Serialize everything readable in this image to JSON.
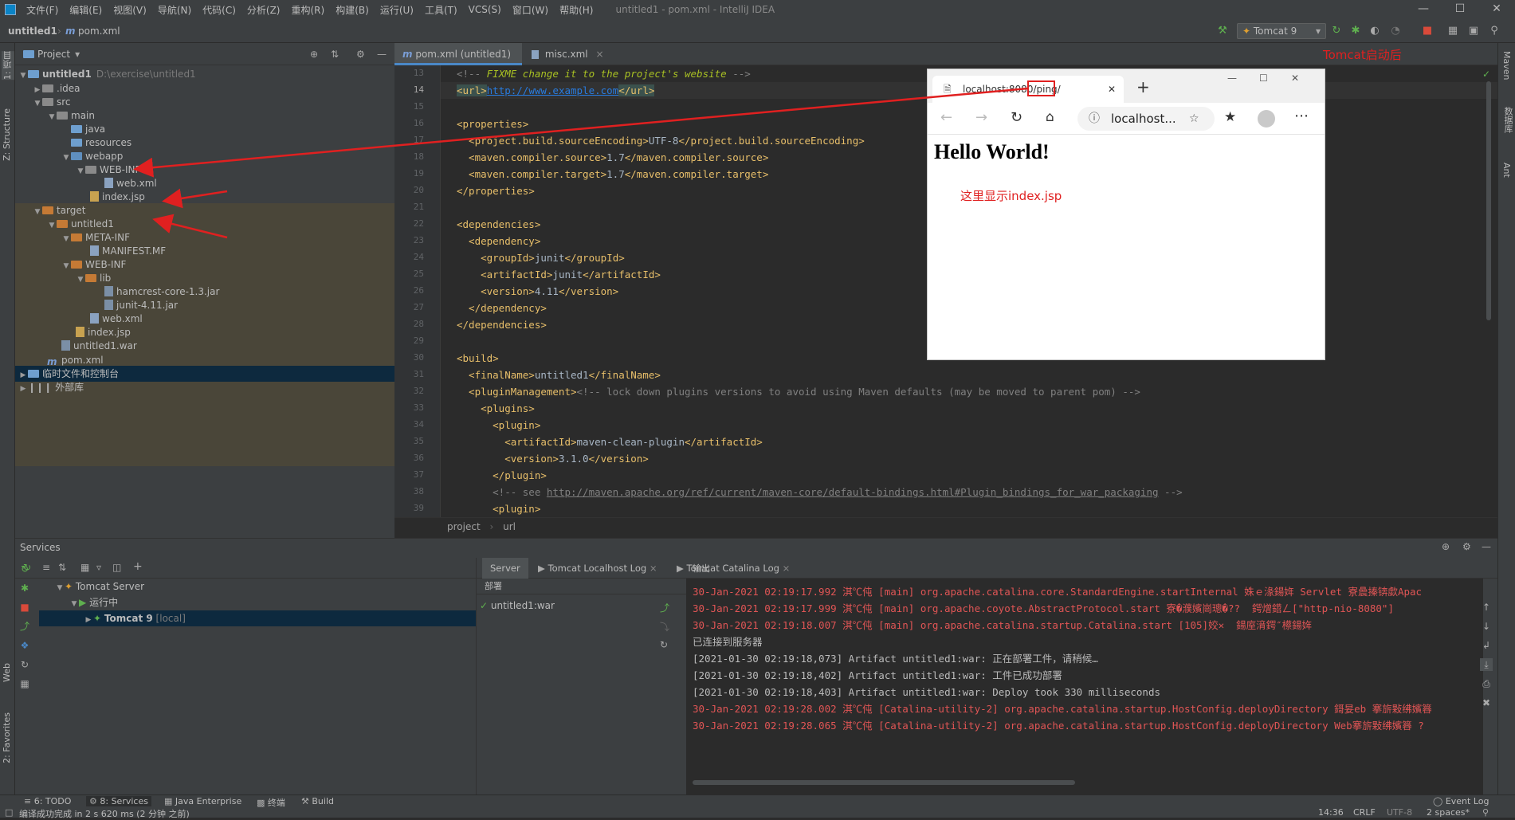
{
  "menubar": {
    "items": [
      "文件(F)",
      "编辑(E)",
      "视图(V)",
      "导航(N)",
      "代码(C)",
      "分析(Z)",
      "重构(R)",
      "构建(B)",
      "运行(U)",
      "工具(T)",
      "VCS(S)",
      "窗口(W)",
      "帮助(H)"
    ],
    "window_title": "untitled1 - pom.xml - IntelliJ IDEA"
  },
  "navbar": {
    "project": "untitled1",
    "file": "pom.xml",
    "run_config": "Tomcat 9"
  },
  "left_stripe": {
    "project_tab": "1: 项目",
    "structure_tab": "Z: Structure",
    "web_tab": "Web",
    "favorites_tab": "2: Favorites"
  },
  "right_stripe": {
    "maven_tab": "Maven",
    "database_tab": "数据库",
    "ant_tab": "Ant"
  },
  "project_panel": {
    "header": "Project",
    "tree": {
      "root": "untitled1",
      "root_path": "D:\\exercise\\untitled1",
      "idea": ".idea",
      "src": "src",
      "main": "main",
      "java": "java",
      "resources": "resources",
      "webapp": "webapp",
      "webinf": "WEB-INF",
      "webxml": "web.xml",
      "indexjsp": "index.jsp",
      "target": "target",
      "t_untitled1": "untitled1",
      "metainf": "META-INF",
      "manifest": "MANIFEST.MF",
      "t_webinf": "WEB-INF",
      "lib": "lib",
      "hamcrest": "hamcrest-core-1.3.jar",
      "junit": "junit-4.11.jar",
      "t_webxml": "web.xml",
      "t_indexjsp": "index.jsp",
      "war": "untitled1.war",
      "pom": "pom.xml",
      "scratches": "临时文件和控制台",
      "extlibs": "外部库"
    }
  },
  "editor": {
    "tabs": [
      "pom.xml (untitled1)",
      "misc.xml"
    ],
    "line_numbers": [
      "13",
      "14",
      "15",
      "16",
      "17",
      "18",
      "19",
      "20",
      "21",
      "22",
      "23",
      "24",
      "25",
      "26",
      "27",
      "28",
      "29",
      "30",
      "31",
      "32",
      "33",
      "34",
      "35",
      "36",
      "37",
      "38",
      "39"
    ],
    "lines": {
      "l13a": "<!-- ",
      "l13b": "FIXME change it to the project's website",
      "l13c": " -->",
      "l14a": "<url>",
      "l14b": "http://www.example.com",
      "l14c": "</url>",
      "l16": "<properties>",
      "l17a": "  <project.build.sourceEncoding>",
      "l17b": "UTF-8",
      "l17c": "</project.build.sourceEncoding>",
      "l18a": "  <maven.compiler.source>",
      "l18b": "1.7",
      "l18c": "</maven.compiler.source>",
      "l19a": "  <maven.compiler.target>",
      "l19b": "1.7",
      "l19c": "</maven.compiler.target>",
      "l20": "</properties>",
      "l22": "<dependencies>",
      "l23": "  <dependency>",
      "l24a": "    <groupId>",
      "l24b": "junit",
      "l24c": "</groupId>",
      "l25a": "    <artifactId>",
      "l25b": "junit",
      "l25c": "</artifactId>",
      "l26a": "    <version>",
      "l26b": "4.11",
      "l26c": "</version>",
      "l27": "  </dependency>",
      "l28": "</dependencies>",
      "l30": "<build>",
      "l31a": "  <finalName>",
      "l31b": "untitled1",
      "l31c": "</finalName>",
      "l32a": "  <pluginManagement>",
      "l32b": "<!-- lock down plugins versions to avoid using Maven defaults (may be moved to parent pom) -->",
      "l33": "    <plugins>",
      "l34": "      <plugin>",
      "l35a": "        <artifactId>",
      "l35b": "maven-clean-plugin",
      "l35c": "</artifactId>",
      "l36a": "        <version>",
      "l36b": "3.1.0",
      "l36c": "</version>",
      "l37": "      </plugin>",
      "l38a": "      <!-- see ",
      "l38b": "http://maven.apache.org/ref/current/maven-core/default-bindings.html#Plugin_bindings_for_war_packaging",
      "l38c": " -->",
      "l39": "      <plugin>"
    },
    "breadcrumb": [
      "project",
      "url"
    ]
  },
  "browser": {
    "tab_title_host": "localhost:8080",
    "tab_title_path": "/ping/",
    "address": "localhost...",
    "heading": "Hello World!"
  },
  "annotations": {
    "tomcat_after": "Tomcat启动后",
    "shows_index": "这里显示index.jsp"
  },
  "services": {
    "title": "Services",
    "tree": {
      "server": "Tomcat Server",
      "running": "运行中",
      "tomcat9": "Tomcat 9",
      "local": "[local]"
    },
    "tabs": [
      "Server",
      "Tomcat Localhost Log",
      "Tomcat Catalina Log"
    ],
    "deploy_header": "部署",
    "deploy_item": "untitled1:war",
    "output_header": "输出",
    "output_lines": [
      "30-Jan-2021 02:19:17.992 淇℃伅 [main] org.apache.catalina.core.StandardEngine.startInternal 姝ｅ湪鍚姩 Servlet 寮曟搸锛歔Apac",
      "30-Jan-2021 02:19:17.999 淇℃伅 [main] org.apache.coyote.AbstractProtocol.start 寮�濮嬪崗璁�??  鍔熷鍣ㄥ[\"http-nio-8080\"]",
      "30-Jan-2021 02:19:18.007 淇℃伅 [main] org.apache.catalina.startup.Catalina.start [105]姣✕  鍚庢湇鍔″櫒鍚姩",
      "已连接到服务器",
      "[2021-01-30 02:19:18,073] Artifact untitled1:war: 正在部署工件，请稍候…",
      "[2021-01-30 02:19:18,402] Artifact untitled1:war: 工件已成功部署",
      "[2021-01-30 02:19:18,403] Artifact untitled1:war: Deploy took 330 milliseconds",
      "30-Jan-2021 02:19:28.002 淇℃伅 [Catalina-utility-2] org.apache.catalina.startup.HostConfig.deployDirectory 鎶妟eb 搴旂敤绋嬪簭",
      "30-Jan-2021 02:19:28.065 淇℃伅 [Catalina-utility-2] org.apache.catalina.startup.HostConfig.deployDirectory Web搴旂敤绋嬪簭 ?"
    ]
  },
  "tool_tabs": {
    "todo": "6: TODO",
    "services": "8: Services",
    "java_ee": "Java Enterprise",
    "terminal": "终端",
    "build": "Build",
    "event_log": "Event Log"
  },
  "status": {
    "message": "编译成功完成 in 2 s 620 ms (2 分钟 之前)",
    "position": "14:36",
    "line_sep": "CRLF",
    "encoding": "UTF-8",
    "indent": "2 spaces*"
  },
  "colors": {
    "accent_blue": "#4a88c7",
    "annotation_red": "#e02020",
    "error_red": "#e05555",
    "tag_yellow": "#e8bf6a"
  }
}
